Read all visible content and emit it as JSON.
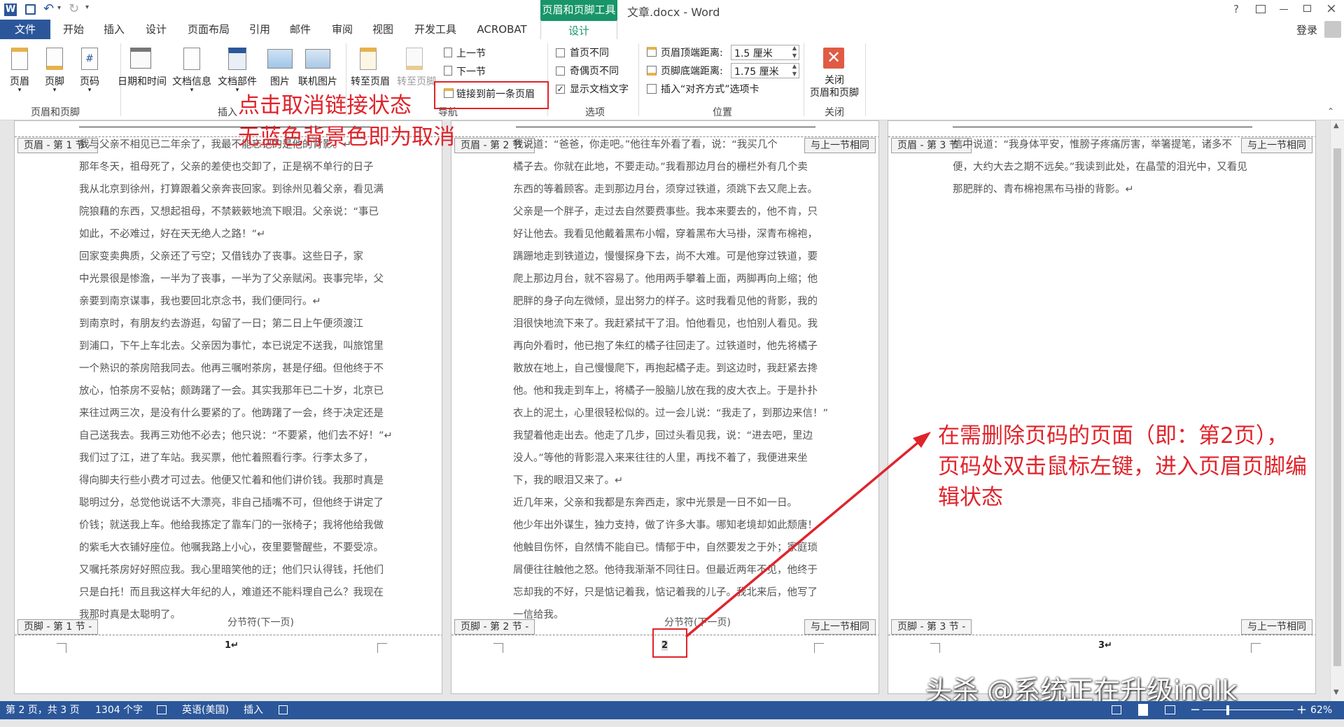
{
  "window": {
    "contextual_tool": "页眉和页脚工具",
    "title": "文章.docx - Word",
    "help": "?",
    "login": "登录"
  },
  "tabs": {
    "file": "文件",
    "home": "开始",
    "insert": "插入",
    "design": "设计",
    "layout": "页面布局",
    "references": "引用",
    "mail": "邮件",
    "review": "审阅",
    "view": "视图",
    "developer": "开发工具",
    "acrobat": "ACROBAT",
    "hf_design": "设计"
  },
  "ribbon": {
    "header": "页眉",
    "footer": "页脚",
    "page_number": "页码",
    "group_hf": "页眉和页脚",
    "datetime": "日期和时间",
    "docinfo": "文档信息",
    "quickparts": "文档部件",
    "pictures": "图片",
    "online_pictures": "联机图片",
    "group_insert": "插入",
    "goto_header": "转至页眉",
    "goto_footer": "转至页脚",
    "previous": "上一节",
    "next": "下一节",
    "link_previous": "链接到前一条页眉",
    "group_nav": "导航",
    "diff_first": "首页不同",
    "diff_odd_even": "奇偶页不同",
    "show_text": "显示文档文字",
    "group_options": "选项",
    "header_top_label": "页眉顶端距离:",
    "header_top_value": "1.5 厘米",
    "footer_bottom_label": "页脚底端距离:",
    "footer_bottom_value": "1.75 厘米",
    "insert_align_tab": "插入“对齐方式”选项卡",
    "group_position": "位置",
    "close_line1": "关闭",
    "close_line2": "页眉和页脚",
    "group_close": "关闭"
  },
  "options_state": {
    "diff_first": false,
    "diff_odd_even": false,
    "show_text": true
  },
  "pages": [
    {
      "header_tag": "页眉 - 第 1 节 -",
      "footer_tag": "页脚 - 第 1 节 -",
      "same_tag": "",
      "page_number": "1↵",
      "lines": [
        "我与父亲不相见已二年余了，我最不能忘记的是他的背影。↵",
        "那年冬天，祖母死了，父亲的差使也交卸了，正是祸不单行的日子",
        "我从北京到徐州，打算跟着父亲奔丧回家。到徐州见着父亲，看见满",
        "院狼藉的东西，又想起祖母，不禁簌簌地流下眼泪。父亲说：“事已",
        "如此，不必难过，好在天无绝人之路！”↵",
        "回家变卖典质，父亲还了亏空；又借钱办了丧事。这些日子，家",
        "中光景很是惨澹，一半为了丧事，一半为了父亲赋闲。丧事完毕，父",
        "亲要到南京谋事，我也要回北京念书，我们便同行。↵",
        "到南京时，有朋友约去游逛，勾留了一日；第二日上午便须渡江",
        "到浦口，下午上车北去。父亲因为事忙，本已说定不送我，叫旅馆里",
        "一个熟识的茶房陪我同去。他再三嘱咐茶房，甚是仔细。但他终于不",
        "放心，怕茶房不妥帖；颇踌躇了一会。其实我那年已二十岁，北京已",
        "来往过两三次，是没有什么要紧的了。他踌躇了一会，终于决定还是",
        "自己送我去。我再三劝他不必去；他只说：“不要紧，他们去不好！”↵",
        "我们过了江，进了车站。我买票，他忙着照看行李。行李太多了，",
        "得向脚夫行些小费才可过去。他便又忙着和他们讲价钱。我那时真是",
        "聪明过分，总觉他说话不大漂亮，非自己插嘴不可，但他终于讲定了",
        "价钱；就送我上车。他给我拣定了靠车门的一张椅子；我将他给我做",
        "的紫毛大衣铺好座位。他嘱我路上小心，夜里要警醒些，不要受凉。",
        "又嘱托茶房好好照应我。我心里暗笑他的迂；他们只认得钱，托他们",
        "只是白托！而且我这样大年纪的人，难道还不能料理自己么？我现在",
        "我那时真是太聪明了。"
      ]
    },
    {
      "header_tag": "页眉 - 第 2 节 -",
      "footer_tag": "页脚 - 第 2 节 -",
      "same_tag": "与上一节相同",
      "page_number": "2",
      "lines": [
        "我说道：“爸爸，你走吧。”他往车外看了看，说：“我买几个",
        "橘子去。你就在此地，不要走动。”我看那边月台的栅栏外有几个卖",
        "东西的等着顾客。走到那边月台，须穿过铁道，须跳下去又爬上去。",
        "父亲是一个胖子，走过去自然要费事些。我本来要去的，他不肯，只",
        "好让他去。我看见他戴着黑布小帽，穿着黑布大马褂，深青布棉袍，",
        "蹒跚地走到铁道边，慢慢探身下去，尚不大难。可是他穿过铁道，要",
        "爬上那边月台，就不容易了。他用两手攀着上面，两脚再向上缩；他",
        "肥胖的身子向左微倾，显出努力的样子。这时我看见他的背影，我的",
        "泪很快地流下来了。我赶紧拭干了泪。怕他看见，也怕别人看见。我",
        "再向外看时，他已抱了朱红的橘子往回走了。过铁道时，他先将橘子",
        "散放在地上，自己慢慢爬下，再抱起橘子走。到这边时，我赶紧去搀",
        "他。他和我走到车上，将橘子一股脑儿放在我的皮大衣上。于是扑扑",
        "衣上的泥土，心里很轻松似的。过一会儿说：“我走了，到那边来信！”",
        "我望着他走出去。他走了几步，回过头看见我，说：“进去吧，里边",
        "没人。”等他的背影混入来来往往的人里，再找不着了，我便进来坐",
        "下，我的眼泪又来了。↵",
        "近几年来，父亲和我都是东奔西走，家中光景是一日不如一日。",
        "他少年出外谋生，独力支持，做了许多大事。哪知老境却如此颓唐！",
        "他触目伤怀，自然情不能自已。情郁于中，自然要发之于外；家庭琐",
        "屑便往往触他之怒。他待我渐渐不同往日。但最近两年不见，他终于",
        "忘却我的不好，只是惦记着我，惦记着我的儿子。我北来后，他写了",
        "一信给我。"
      ]
    },
    {
      "header_tag": "页眉 - 第 3 节 -",
      "footer_tag": "页脚 - 第 3 节 -",
      "same_tag": "与上一节相同",
      "page_number": "3↵",
      "lines": [
        "信中说道：“我身体平安，惟膀子疼痛厉害，举箸提笔，诸多不",
        "便，大约大去之期不远矣。”我读到此处，在晶莹的泪光中，又看见",
        "那肥胖的、青布棉袍黑布马褂的背影。↵"
      ]
    }
  ],
  "section_break": "分节符(下一页)",
  "annotations": {
    "line1": "点击取消链接状态",
    "line2": "无蓝色背景色即为取消",
    "right1": "在需删除页码的页面（即：第2页），",
    "right2": "页码处双击鼠标左键，进入页眉页脚编",
    "right3": "辑状态",
    "watermark": "头杀 @系统正在升级inglk"
  },
  "status": {
    "page": "第 2 页，共 3 页",
    "words": "1304 个字",
    "language": "英语(美国)",
    "mode": "插入",
    "zoom": "62%"
  },
  "colors": {
    "word_blue": "#2b579a",
    "hf_tools": "#19956a",
    "annotation_red": "#e0242b"
  }
}
